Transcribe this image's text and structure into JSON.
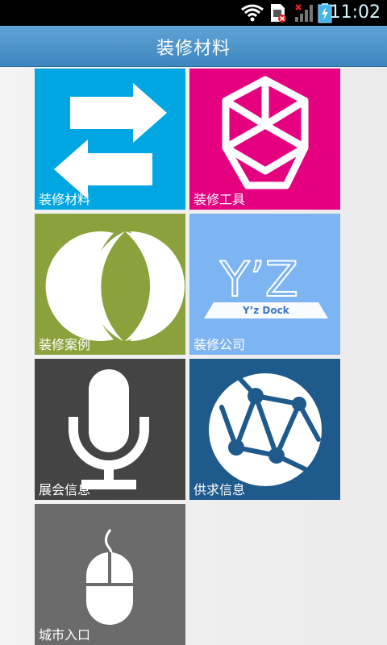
{
  "status_bar": {
    "time": "11:02",
    "icons": [
      "wifi-icon",
      "sim-card-icon",
      "signal-icon",
      "battery-charging-icon"
    ]
  },
  "header": {
    "title": "装修材料"
  },
  "tiles": [
    {
      "label": "装修材料",
      "icon": "arrows-exchange-icon",
      "color": "#00a6e2"
    },
    {
      "label": "装修工具",
      "icon": "lattice-logo-icon",
      "color": "#e4007f"
    },
    {
      "label": "装修案例",
      "icon": "crescent-circle-icon",
      "color": "#8ba23c"
    },
    {
      "label": "装修公司",
      "icon": "yz-dock-icon",
      "color": "#7db4f2",
      "icon_text": "Y’Z",
      "icon_subtext": "Y’z Dock"
    },
    {
      "label": "展会信息",
      "icon": "microphone-icon",
      "color": "#444444"
    },
    {
      "label": "供求信息",
      "icon": "globe-network-icon",
      "color": "#1f5a8c"
    },
    {
      "label": "城市入口",
      "icon": "mouse-icon",
      "color": "#6b6b6b"
    }
  ]
}
